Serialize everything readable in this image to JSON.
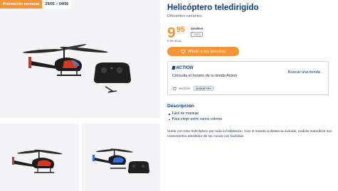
{
  "promo": {
    "label": "Promoción semanal",
    "dates": "29/05 – 04/06"
  },
  "product": {
    "title": "Helicóptero teledirigido",
    "subtitle": "Diferentes variantes"
  },
  "price": {
    "integer": "9",
    "decimal": "95",
    "old_price": "12,95 €",
    "discount": "-23%",
    "unit_price": "9,95 €/ud.",
    "accent_color": "#f79433"
  },
  "favorites_button": {
    "label": "Añadir a tus favoritos",
    "icon": "heart-icon"
  },
  "store": {
    "brand": "ACTION",
    "hours_text": "Consulta el horario de tu tienda Action",
    "search_link": "Buscar una tienda",
    "section_label": "Sección:",
    "section_value": "JUGUETES",
    "section_icon": "cart-icon"
  },
  "description": {
    "heading": "Descripción",
    "features": [
      "Fácil de manejar",
      "Para elegir entre varios colores"
    ],
    "text": "Vuela con este helicóptero por toda la habitación. Con el mando a distancia incluido, podrás maniobrar sus movimientos alrededor de las cosas con facilidad."
  },
  "colors": {
    "brand_blue": "#0d3a80",
    "promo_orange": "#f79433",
    "gallery_bg": "#f4f4f6"
  }
}
